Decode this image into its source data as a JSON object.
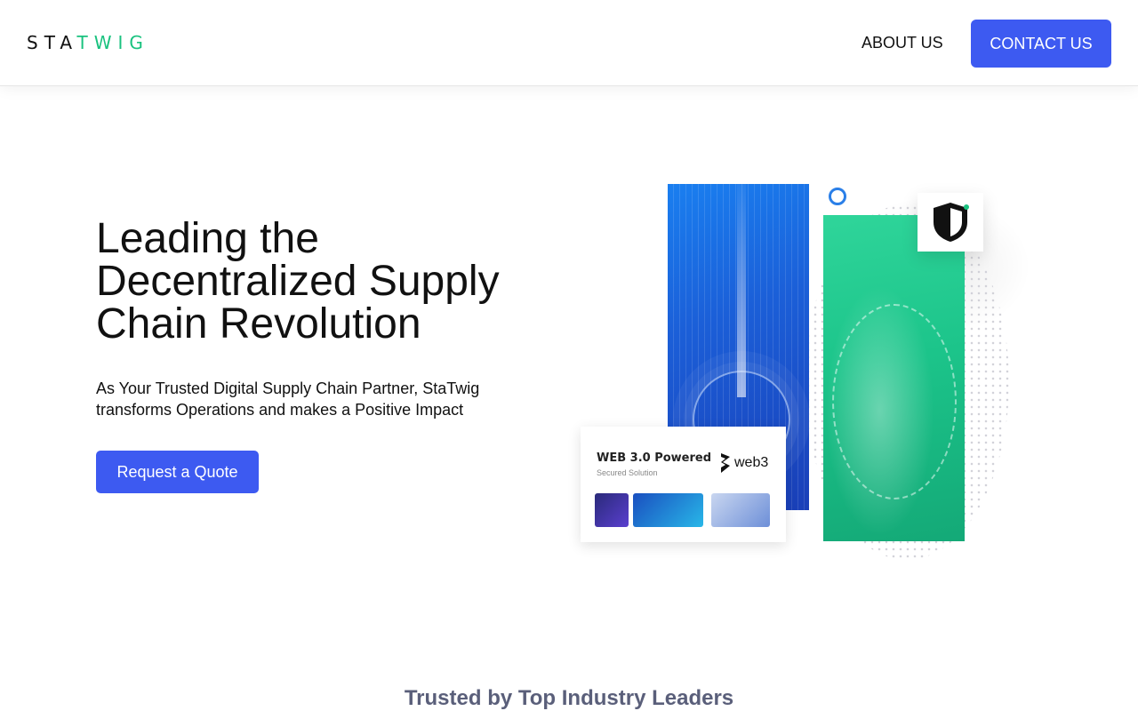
{
  "header": {
    "logo_dark": "STA",
    "logo_green": "TWIG",
    "nav_about": "ABOUT US",
    "nav_contact": "CONTACT US"
  },
  "hero": {
    "title": "Leading the Decentralized Supply Chain Revolution",
    "subtitle": "As Your Trusted Digital Supply Chain Partner, StaTwig transforms Operations and makes a Positive Impact",
    "cta": "Request a Quote"
  },
  "illustration": {
    "card_title": "WEB 3.0 Powered",
    "card_subtitle": "Secured Solution",
    "card_logo_text": "web3",
    "icons": [
      "shield-icon",
      "web3-logo-icon"
    ]
  },
  "trusted": {
    "heading": "Trusted by Top Industry Leaders"
  },
  "colors": {
    "primary": "#3d5af1",
    "logo_green": "#1ac27f",
    "panel_blue": "#1b5fd8",
    "panel_green": "#1cc48a"
  }
}
